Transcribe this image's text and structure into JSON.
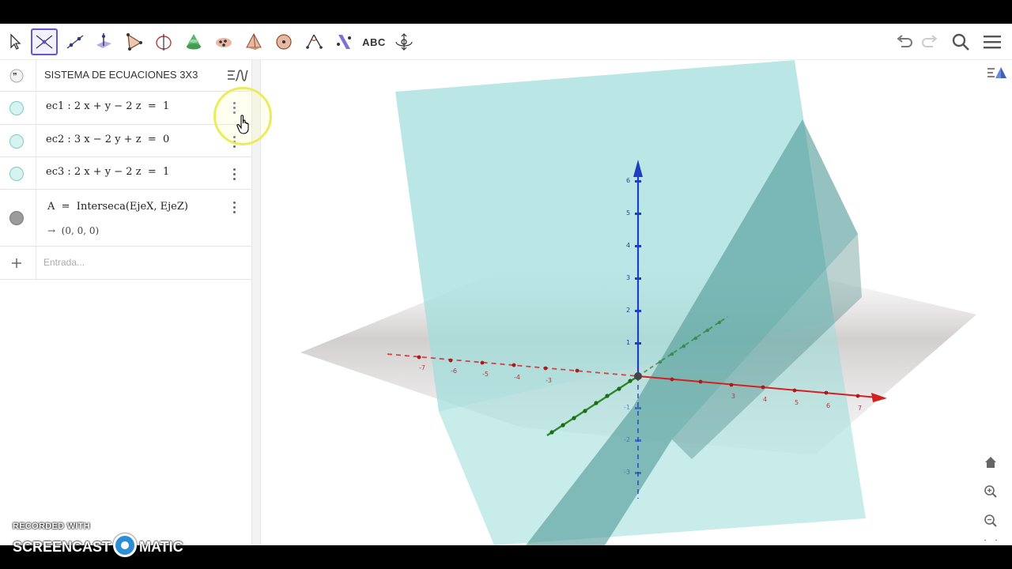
{
  "toolbar": {
    "tools": [
      {
        "name": "move-tool",
        "x": 6
      },
      {
        "name": "intersect-tool",
        "x": 40,
        "selected": true
      },
      {
        "name": "line-tool",
        "x": 78
      },
      {
        "name": "perpendicular-tool",
        "x": 116
      },
      {
        "name": "plane-tool",
        "x": 116
      },
      {
        "name": "polygon-tool",
        "x": 154
      },
      {
        "name": "circle-axis-tool",
        "x": 192
      },
      {
        "name": "cone-tool",
        "x": 230
      },
      {
        "name": "net-tool",
        "x": 268
      },
      {
        "name": "pyramid-tool",
        "x": 306
      },
      {
        "name": "sphere-tool",
        "x": 344
      },
      {
        "name": "angle-tool",
        "x": 382
      },
      {
        "name": "reflect-tool",
        "x": 420
      }
    ],
    "abc_label": "ABC",
    "right": [
      "undo-icon",
      "redo-icon",
      "search-icon",
      "menu-icon"
    ]
  },
  "algebra": {
    "header_title": "SISTEMA DE ECUACIONES 3X3",
    "rows": [
      {
        "label": "ec1 :",
        "expr": "2 x + y − 2 z  =  1"
      },
      {
        "label": "ec2 :",
        "expr": "3 x − 2 y + z  =  0"
      },
      {
        "label": "ec3 :",
        "expr": "2 x + y − 2 z  =  1"
      }
    ],
    "point_def": "A  =  Interseca(EjeX, EjeZ)",
    "point_value": "→  (0, 0, 0)",
    "input_placeholder": "Entrada..."
  },
  "view3d": {
    "z_ticks": [
      "6",
      "5",
      "4",
      "3",
      "2",
      "1",
      "-1",
      "-2",
      "-3"
    ],
    "x_ticks": [
      "-7",
      "-6",
      "-5",
      "-4",
      "-3",
      "3",
      "4",
      "5",
      "6",
      "7"
    ],
    "side_buttons": [
      "home-icon",
      "zoom-in-icon",
      "zoom-out-icon",
      "fullscreen-icon"
    ]
  },
  "watermark": {
    "line1": "RECORDED WITH",
    "line2a": "SCREENCAST",
    "line2b": "MATIC"
  },
  "colors": {
    "accent": "#6557d2",
    "plane_cyan": "#9fdedb",
    "x_axis": "#d42020",
    "y_axis": "#2a8a2a",
    "z_axis": "#1f3fc2"
  }
}
